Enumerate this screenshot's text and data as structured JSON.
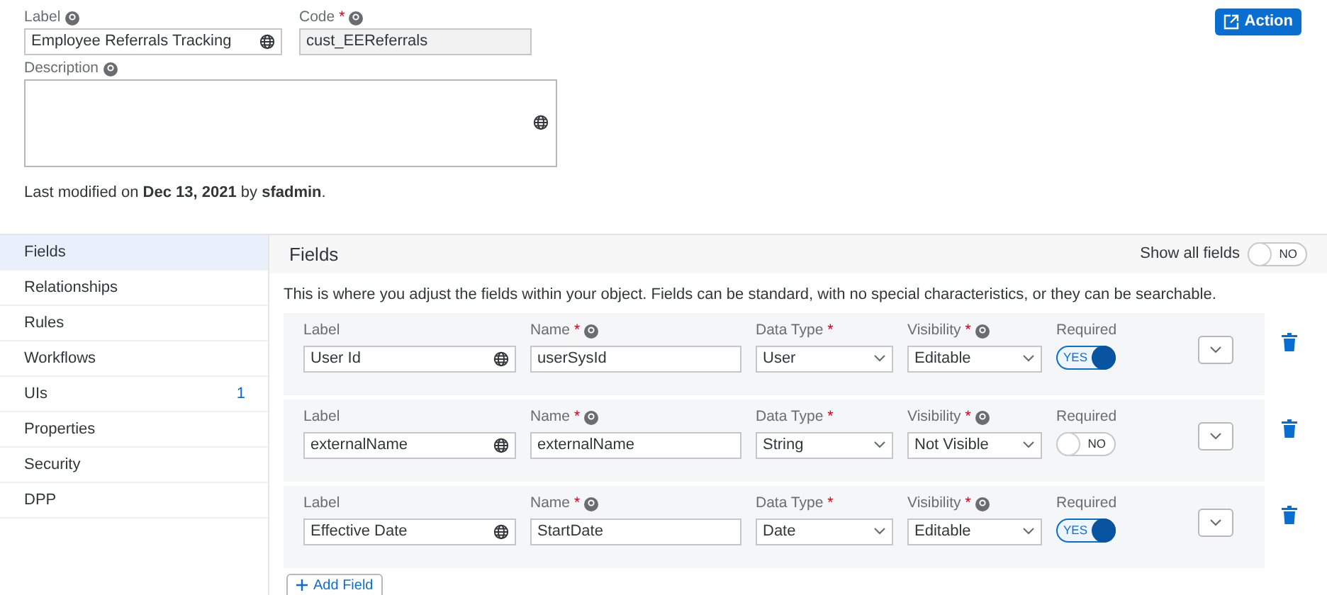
{
  "header": {
    "label": {
      "title": "Label",
      "value": "Employee Referrals Tracking"
    },
    "code": {
      "title": "Code",
      "mark": "*",
      "value": "cust_EEReferrals"
    },
    "description": {
      "title": "Description"
    },
    "action_button": "Action",
    "last_modified": "Last modified on **Dec 13, 2021** by **sfadmin**."
  },
  "sidebar": {
    "items": [
      {
        "label": "Fields",
        "selected": true
      },
      {
        "label": "Relationships",
        "selected": false
      },
      {
        "label": "Rules",
        "selected": false
      },
      {
        "label": "Workflows",
        "selected": false
      },
      {
        "label": "UIs",
        "selected": false,
        "count": "1"
      },
      {
        "label": "Properties",
        "selected": false
      },
      {
        "label": "Security",
        "selected": false
      },
      {
        "label": "DPP",
        "selected": false
      }
    ]
  },
  "fields_panel": {
    "title": "Fields",
    "show_all": {
      "label": "Show all fields",
      "on": false,
      "text": "NO"
    },
    "intro": "This is where you adjust the fields within your object. Fields can be standard, with no special characteristics, or they can be searchable.",
    "rows": [
      {
        "labels": {
          "label": "Label",
          "name": "Name",
          "name_mark": "*",
          "data_type": "Data Type",
          "data_type_mark": "*",
          "visibility": "Visibility",
          "visibility_mark": "*",
          "required": "Required"
        },
        "label": "User Id",
        "name": "userSysId",
        "data_type": "User",
        "visibility": "Editable",
        "required": true,
        "required_text": "YES"
      },
      {
        "labels": {
          "label": "Label",
          "name": "Name",
          "name_mark": "*",
          "data_type": "Data Type",
          "data_type_mark": "*",
          "visibility": "Visibility",
          "visibility_mark": "*",
          "required": "Required"
        },
        "label": "externalName",
        "name": "externalName",
        "data_type": "String",
        "visibility": "Not Visible",
        "required": false,
        "required_text": "NO"
      },
      {
        "labels": {
          "label": "Label",
          "name": "Name",
          "name_mark": "*",
          "data_type": "Data Type",
          "data_type_mark": "*",
          "visibility": "Visibility",
          "visibility_mark": "*",
          "required": "Required"
        },
        "label": "Effective Date",
        "name": "StartDate",
        "data_type": "Date",
        "visibility": "Editable",
        "required": true,
        "required_text": "YES"
      }
    ],
    "add_button": "Add Field"
  }
}
